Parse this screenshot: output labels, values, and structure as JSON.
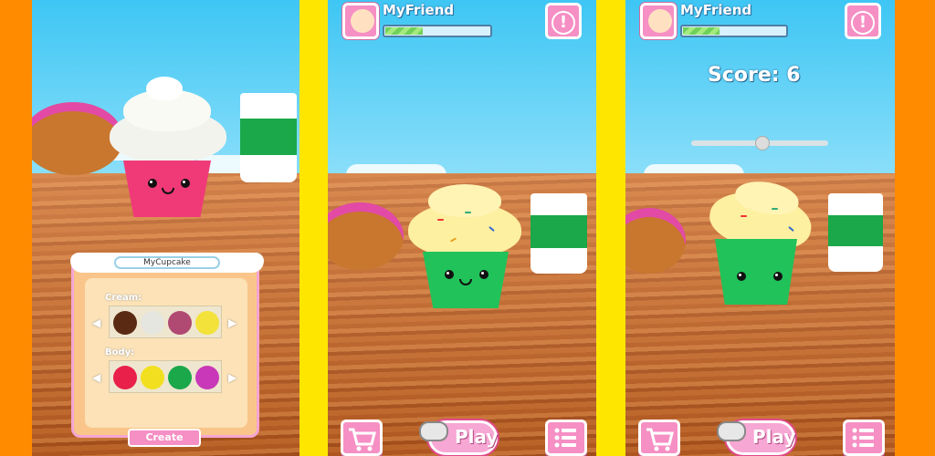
{
  "colors": {
    "orange": "#ff8c00",
    "yellow": "#ffe600",
    "pink": "#f58fc4"
  },
  "panel1": {
    "customize": {
      "title": "MyCupcake",
      "cream_label": "Cream:",
      "body_label": "Body:",
      "create_label": "Create",
      "cream_swatches": [
        "#5a2a12",
        "#e6e6e0",
        "#b04a72",
        "#f2e23a"
      ],
      "body_swatches": [
        "#e8204a",
        "#f2e020",
        "#1aa84a",
        "#c838b8"
      ]
    }
  },
  "panel2": {
    "pet_name": "MyFriend",
    "alert_label": "!",
    "play_label": "Play",
    "progress": 0.35
  },
  "panel3": {
    "pet_name": "MyFriend",
    "alert_label": "!",
    "score_text": "Score: 6",
    "play_label": "Play",
    "progress": 0.35
  }
}
